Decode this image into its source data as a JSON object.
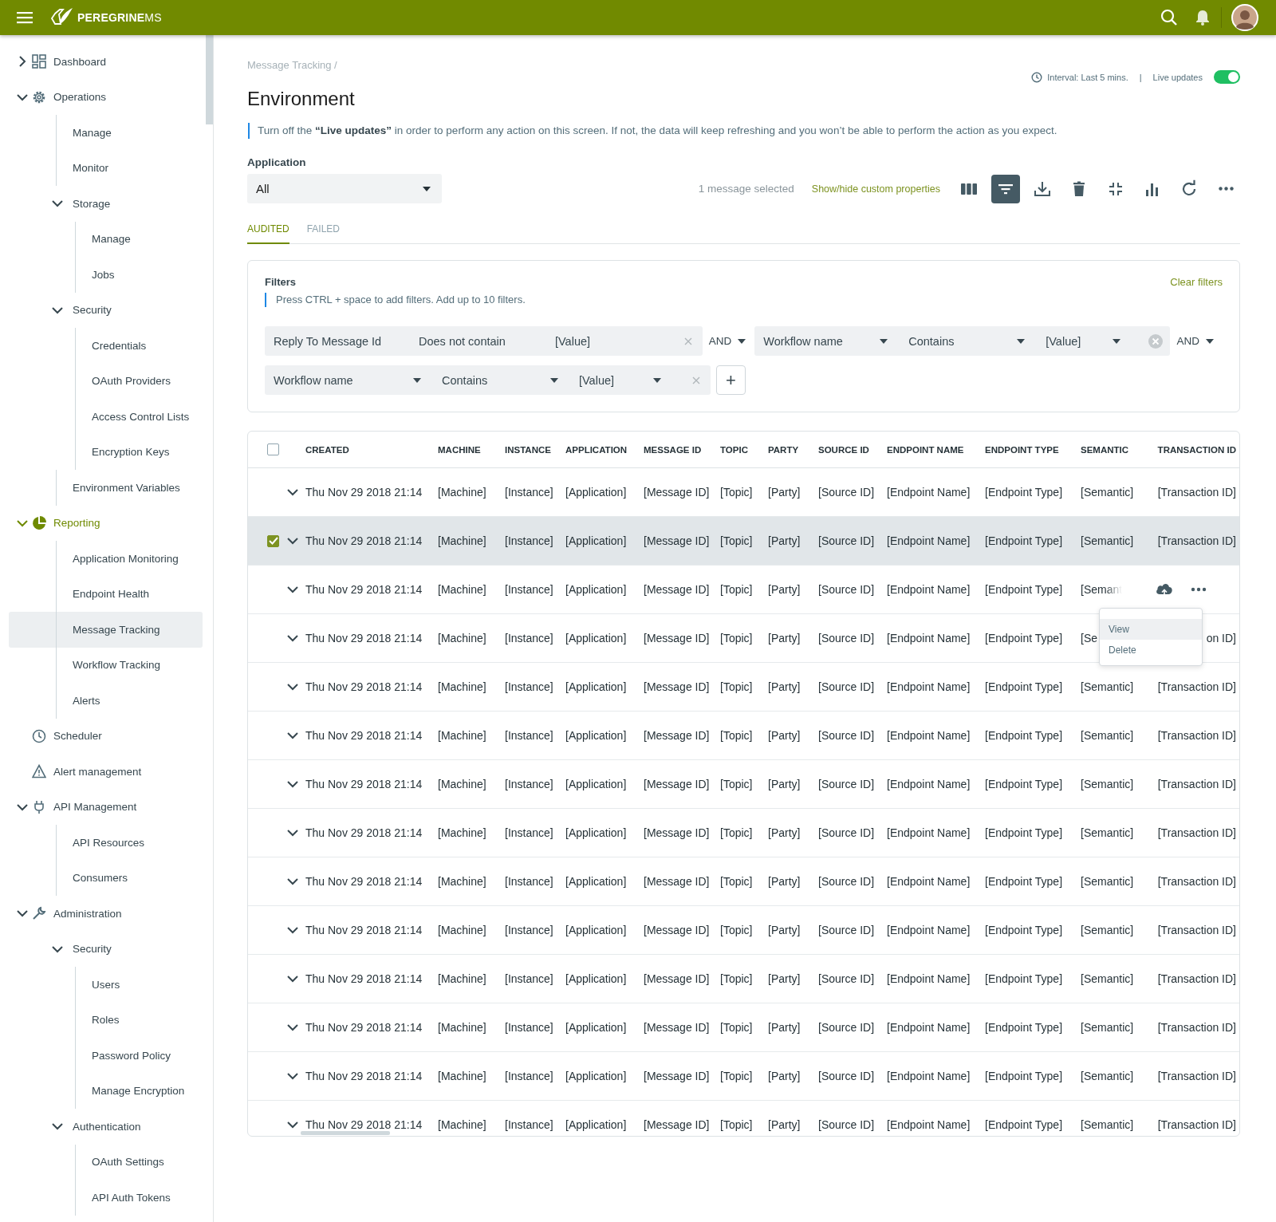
{
  "app": {
    "brand": "**PEREGRINE**MS"
  },
  "sidebar": {
    "items": [
      {
        "label": "Dashboard",
        "kind": "dashboard",
        "expanded": false,
        "selected": false
      },
      {
        "label": "Operations",
        "kind": "gear",
        "expanded": true,
        "selected": false,
        "children": [
          {
            "label": "Manage",
            "selected": false
          },
          {
            "label": "Monitor",
            "selected": false
          },
          {
            "label": "Storage",
            "expanded": true,
            "selected": false,
            "children": [
              {
                "label": "Manage",
                "selected": false
              },
              {
                "label": "Jobs",
                "selected": false
              }
            ]
          },
          {
            "label": "Security",
            "expanded": true,
            "selected": false,
            "children": [
              {
                "label": "Credentials",
                "selected": false
              },
              {
                "label": "OAuth Providers",
                "selected": false
              },
              {
                "label": "Access Control Lists",
                "selected": false
              },
              {
                "label": "Encryption Keys",
                "selected": false
              }
            ]
          },
          {
            "label": "Environment Variables",
            "selected": false
          }
        ]
      },
      {
        "label": "Reporting",
        "kind": "pie",
        "expanded": true,
        "selected": false,
        "children": [
          {
            "label": "Application Monitoring",
            "selected": false
          },
          {
            "label": "Endpoint Health",
            "selected": false
          },
          {
            "label": "Message Tracking",
            "selected": true
          },
          {
            "label": "Workflow Tracking",
            "selected": false
          },
          {
            "label": "Alerts",
            "selected": false
          }
        ]
      },
      {
        "label": "Scheduler",
        "kind": "clock",
        "selected": false
      },
      {
        "label": "Alert management",
        "kind": "warning",
        "selected": false
      },
      {
        "label": "API Management",
        "kind": "plug",
        "expanded": true,
        "selected": false,
        "children": [
          {
            "label": "API Resources",
            "selected": false
          },
          {
            "label": "Consumers",
            "selected": false
          }
        ]
      },
      {
        "label": "Administration",
        "kind": "wrench",
        "expanded": true,
        "selected": false,
        "children": [
          {
            "label": "Security",
            "expanded": true,
            "selected": false,
            "children": [
              {
                "label": "Users",
                "selected": false
              },
              {
                "label": "Roles",
                "selected": false
              },
              {
                "label": "Password Policy",
                "selected": false
              },
              {
                "label": "Manage Encryption",
                "selected": false
              }
            ]
          },
          {
            "label": "Authentication",
            "expanded": true,
            "selected": false,
            "children": [
              {
                "label": "OAuth Settings",
                "selected": false
              },
              {
                "label": "API Auth Tokens",
                "selected": false
              }
            ]
          }
        ]
      }
    ]
  },
  "breadcrumb": "Message Tracking /",
  "title": "Environment",
  "interval": {
    "label": "Interval: Last 5 mins.",
    "separator": "|"
  },
  "live_updates": {
    "label": "Live updates",
    "on": true
  },
  "notice": "Turn off the **“Live updates”** in order to perform any action on this screen. If not, the data will keep refreshing and you won’t be able to perform the action as you expect.",
  "application": {
    "label": "Application",
    "value": "All"
  },
  "toolbar": {
    "selection": "1 message selected",
    "custom_link": "Show/hide custom properties",
    "buttons": [
      {
        "kind": "columns",
        "selected": false
      },
      {
        "kind": "filter",
        "selected": true
      },
      {
        "kind": "download",
        "selected": false
      },
      {
        "kind": "delete",
        "selected": false
      },
      {
        "kind": "collapse",
        "selected": false
      },
      {
        "kind": "chart",
        "selected": false
      },
      {
        "kind": "refresh",
        "selected": false
      },
      {
        "kind": "more",
        "selected": false
      }
    ]
  },
  "tabs": [
    {
      "label": "AUDITED",
      "selected": true
    },
    {
      "label": "FAILED",
      "selected": false
    }
  ],
  "filters": {
    "title": "Filters",
    "hint": "Press CTRL + space to add filters. Add up to 10 filters.",
    "clear_label": "Clear filters",
    "add_button": "+",
    "rows": [
      [
        {
          "field": "Reply To Message Id",
          "operator": "Does not contain",
          "value": "[Value]",
          "kind": "plain",
          "clear_circled": false,
          "join": "AND"
        },
        {
          "field": "Workflow name",
          "operator": "Contains",
          "value": "[Value]",
          "kind": "dropdown",
          "clear_circled": true,
          "join": "AND"
        }
      ],
      [
        {
          "field": "Workflow name",
          "operator": "Contains",
          "value": "[Value]",
          "kind": "dropdown",
          "clear_circled": false
        }
      ]
    ]
  },
  "table": {
    "select_all": {
      "checked": false
    },
    "columns": [
      "CREATED",
      "MACHINE",
      "INSTANCE",
      "APPLICATION",
      "MESSAGE ID",
      "TOPIC",
      "PARTY",
      "SOURCE ID",
      "ENDPOINT NAME",
      "ENDPOINT TYPE",
      "SEMANTIC",
      "TRANSACTION ID"
    ],
    "rows": [
      {
        "selected": false,
        "cells": [
          "Thu Nov 29 2018 21:14",
          "[Machine]",
          "[Instance]",
          "[Application]",
          "[Message ID]",
          "[Topic]",
          "[Party]",
          "[Source ID]",
          "[Endpoint Name]",
          "[Endpoint Type]",
          "[Semantic]",
          "[Transaction ID]"
        ]
      },
      {
        "selected": true,
        "cells": [
          "Thu Nov 29 2018 21:14",
          "[Machine]",
          "[Instance]",
          "[Application]",
          "[Message ID]",
          "[Topic]",
          "[Party]",
          "[Source ID]",
          "[Endpoint Name]",
          "[Endpoint Type]",
          "[Semantic]",
          "[Transaction ID]"
        ]
      },
      {
        "selected": false,
        "hovered": true,
        "cells": [
          "Thu Nov 29 2018 21:14",
          "[Machine]",
          "[Instance]",
          "[Application]",
          "[Message ID]",
          "[Topic]",
          "[Party]",
          "[Source ID]",
          "[Endpoint Name]",
          "[Endpoint Type]",
          "[Semant"
        ]
      },
      {
        "selected": false,
        "cells": [
          "Thu Nov 29 2018 21:14",
          "[Machine]",
          "[Instance]",
          "[Application]",
          "[Message ID]",
          "[Topic]",
          "[Party]",
          "[Source ID]",
          "[Endpoint Name]",
          "[Endpoint Type]",
          "[Se",
          "on ID]"
        ]
      },
      {
        "selected": false,
        "cells": [
          "Thu Nov 29 2018 21:14",
          "[Machine]",
          "[Instance]",
          "[Application]",
          "[Message ID]",
          "[Topic]",
          "[Party]",
          "[Source ID]",
          "[Endpoint Name]",
          "[Endpoint Type]",
          "[Semantic]",
          "[Transaction ID]"
        ]
      },
      {
        "selected": false,
        "cells": [
          "Thu Nov 29 2018 21:14",
          "[Machine]",
          "[Instance]",
          "[Application]",
          "[Message ID]",
          "[Topic]",
          "[Party]",
          "[Source ID]",
          "[Endpoint Name]",
          "[Endpoint Type]",
          "[Semantic]",
          "[Transaction ID]"
        ]
      },
      {
        "selected": false,
        "cells": [
          "Thu Nov 29 2018 21:14",
          "[Machine]",
          "[Instance]",
          "[Application]",
          "[Message ID]",
          "[Topic]",
          "[Party]",
          "[Source ID]",
          "[Endpoint Name]",
          "[Endpoint Type]",
          "[Semantic]",
          "[Transaction ID]"
        ]
      },
      {
        "selected": false,
        "cells": [
          "Thu Nov 29 2018 21:14",
          "[Machine]",
          "[Instance]",
          "[Application]",
          "[Message ID]",
          "[Topic]",
          "[Party]",
          "[Source ID]",
          "[Endpoint Name]",
          "[Endpoint Type]",
          "[Semantic]",
          "[Transaction ID]"
        ]
      },
      {
        "selected": false,
        "cells": [
          "Thu Nov 29 2018 21:14",
          "[Machine]",
          "[Instance]",
          "[Application]",
          "[Message ID]",
          "[Topic]",
          "[Party]",
          "[Source ID]",
          "[Endpoint Name]",
          "[Endpoint Type]",
          "[Semantic]",
          "[Transaction ID]"
        ]
      },
      {
        "selected": false,
        "cells": [
          "Thu Nov 29 2018 21:14",
          "[Machine]",
          "[Instance]",
          "[Application]",
          "[Message ID]",
          "[Topic]",
          "[Party]",
          "[Source ID]",
          "[Endpoint Name]",
          "[Endpoint Type]",
          "[Semantic]",
          "[Transaction ID]"
        ]
      },
      {
        "selected": false,
        "cells": [
          "Thu Nov 29 2018 21:14",
          "[Machine]",
          "[Instance]",
          "[Application]",
          "[Message ID]",
          "[Topic]",
          "[Party]",
          "[Source ID]",
          "[Endpoint Name]",
          "[Endpoint Type]",
          "[Semantic]",
          "[Transaction ID]"
        ]
      },
      {
        "selected": false,
        "cells": [
          "Thu Nov 29 2018 21:14",
          "[Machine]",
          "[Instance]",
          "[Application]",
          "[Message ID]",
          "[Topic]",
          "[Party]",
          "[Source ID]",
          "[Endpoint Name]",
          "[Endpoint Type]",
          "[Semantic]",
          "[Transaction ID]"
        ]
      },
      {
        "selected": false,
        "cells": [
          "Thu Nov 29 2018 21:14",
          "[Machine]",
          "[Instance]",
          "[Application]",
          "[Message ID]",
          "[Topic]",
          "[Party]",
          "[Source ID]",
          "[Endpoint Name]",
          "[Endpoint Type]",
          "[Semantic]",
          "[Transaction ID]"
        ]
      },
      {
        "selected": false,
        "cells": [
          "Thu Nov 29 2018 21:14",
          "[Machine]",
          "[Instance]",
          "[Application]",
          "[Message ID]",
          "[Topic]",
          "[Party]",
          "[Source ID]",
          "[Endpoint Name]",
          "[Endpoint Type]",
          "[Semantic]",
          "[Transaction ID]"
        ]
      }
    ],
    "row_menu": {
      "items": [
        {
          "label": "View",
          "selected": true
        },
        {
          "label": "Delete",
          "selected": false
        }
      ]
    }
  }
}
